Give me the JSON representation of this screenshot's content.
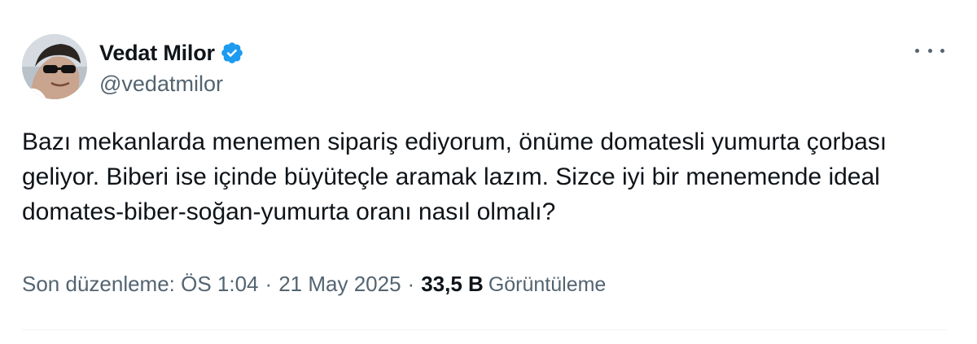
{
  "author": {
    "display_name": "Vedat Milor",
    "handle": "@vedatmilor",
    "verified": true,
    "verified_color": "#1d9bf0"
  },
  "tweet": {
    "text": "Bazı mekanlarda menemen sipariş ediyorum, önüme domatesli yumurta çorbası geliyor. Biberi ise içinde büyüteçle aramak lazım. Sizce iyi bir menemende ideal domates-biber-soğan-yumurta oranı nasıl olmalı?"
  },
  "meta": {
    "edited_label": "Son düzenleme: ÖS 1:04",
    "separator": "·",
    "date": "21 May 2025",
    "views_count": "33,5 B",
    "views_label": "Görüntüleme"
  },
  "icons": {
    "more": "more-options-icon",
    "verified": "verified-badge-icon",
    "avatar": "avatar-photo"
  }
}
